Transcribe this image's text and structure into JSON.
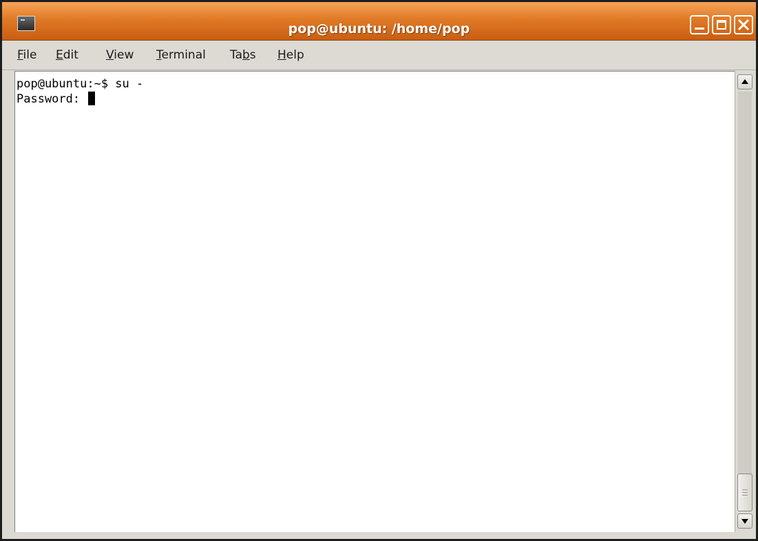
{
  "window": {
    "title": "pop@ubuntu: /home/pop"
  },
  "menu": {
    "items": [
      {
        "mnemonic": "F",
        "rest": "ile"
      },
      {
        "mnemonic": "E",
        "rest": "dit"
      },
      {
        "mnemonic": "V",
        "rest": "iew"
      },
      {
        "mnemonic": "T",
        "rest": "erminal"
      },
      {
        "pre": "Ta",
        "mnemonic": "b",
        "rest": "s"
      },
      {
        "mnemonic": "H",
        "rest": "elp"
      }
    ]
  },
  "terminal": {
    "lines": [
      "pop@ubuntu:~$ su -",
      "Password: "
    ]
  },
  "icons": {
    "app": "terminal-icon",
    "minimize": "minimize-icon",
    "maximize": "maximize-icon",
    "close": "close-icon",
    "scroll_up": "arrow-up-icon",
    "scroll_down": "arrow-down-icon"
  },
  "colors": {
    "titlebar_accent": "#e07a26",
    "chrome": "#ddd9d3",
    "terminal_bg": "#ffffff",
    "terminal_fg": "#000000"
  }
}
